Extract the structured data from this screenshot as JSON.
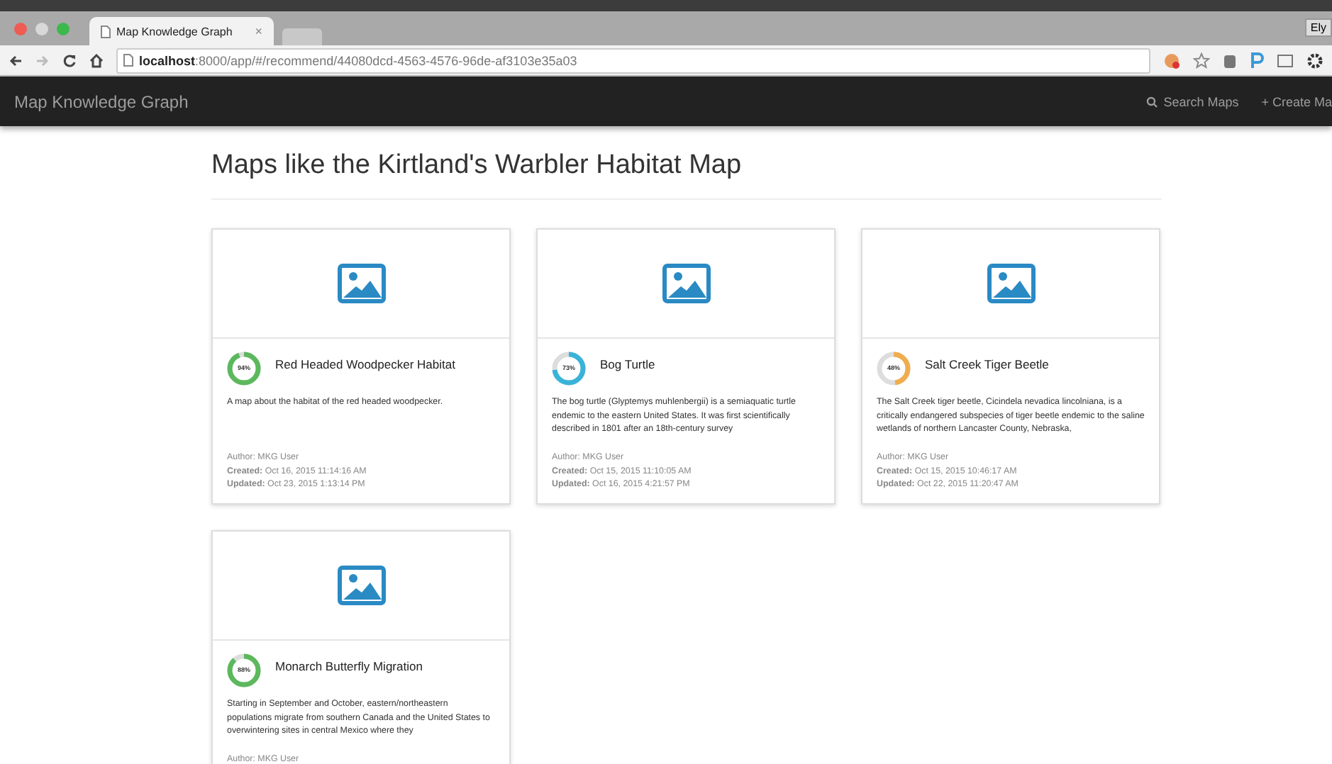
{
  "browser": {
    "tab_title": "Map Knowledge Graph",
    "close": "×",
    "url_host": "localhost",
    "url_path": ":8000/app/#/recommend/44080dcd-4563-4576-96de-af3103e35a03",
    "profile": "Ely"
  },
  "navbar": {
    "brand": "Map Knowledge Graph",
    "links": [
      {
        "kind": "search",
        "label": "Search Maps"
      },
      {
        "kind": "create",
        "label": "+ Create Ma"
      }
    ]
  },
  "heading": "Maps like the Kirtland's Warbler Habitat Map",
  "cards": [
    {
      "title": "Red Headed Woodpecker Habitat",
      "percent": "94%",
      "level": 0.94,
      "color": "#5cb85c",
      "description": "A map about the habitat of the red headed woodpecker.",
      "author_label": "Author:",
      "author": "MKG User",
      "created_label": "Created:",
      "created": "Oct 16, 2015 11:14:16 AM",
      "updated_label": "Updated:",
      "updated": "Oct 23, 2015 1:13:14 PM"
    },
    {
      "title": "Bog Turtle",
      "percent": "73%",
      "level": 0.73,
      "color": "#3ab3d9",
      "description": "The bog turtle (Glyptemys muhlenbergii) is a semiaquatic turtle endemic to the eastern United States. It was first scientifically described in 1801 after an 18th-century survey",
      "author_label": "Author:",
      "author": "MKG User",
      "created_label": "Created:",
      "created": "Oct 15, 2015 11:10:05 AM",
      "updated_label": "Updated:",
      "updated": "Oct 16, 2015 4:21:57 PM"
    },
    {
      "title": "Salt Creek Tiger Beetle",
      "percent": "48%",
      "level": 0.48,
      "color": "#f0ad4e",
      "description": "The Salt Creek tiger beetle, Cicindela nevadica lincolniana, is a critically endangered subspecies of tiger beetle endemic to the saline wetlands of northern Lancaster County, Nebraska,",
      "author_label": "Author:",
      "author": "MKG User",
      "created_label": "Created:",
      "created": "Oct 15, 2015 10:46:17 AM",
      "updated_label": "Updated:",
      "updated": "Oct 22, 2015 11:20:47 AM"
    },
    {
      "title": "Monarch Butterfly Migration",
      "percent": "88%",
      "level": 0.88,
      "color": "#5cb85c",
      "description": "Starting in September and October, eastern/northeastern populations migrate from southern Canada and the United States to overwintering sites in central Mexico where they",
      "author_label": "Author:",
      "author": "MKG User"
    }
  ]
}
